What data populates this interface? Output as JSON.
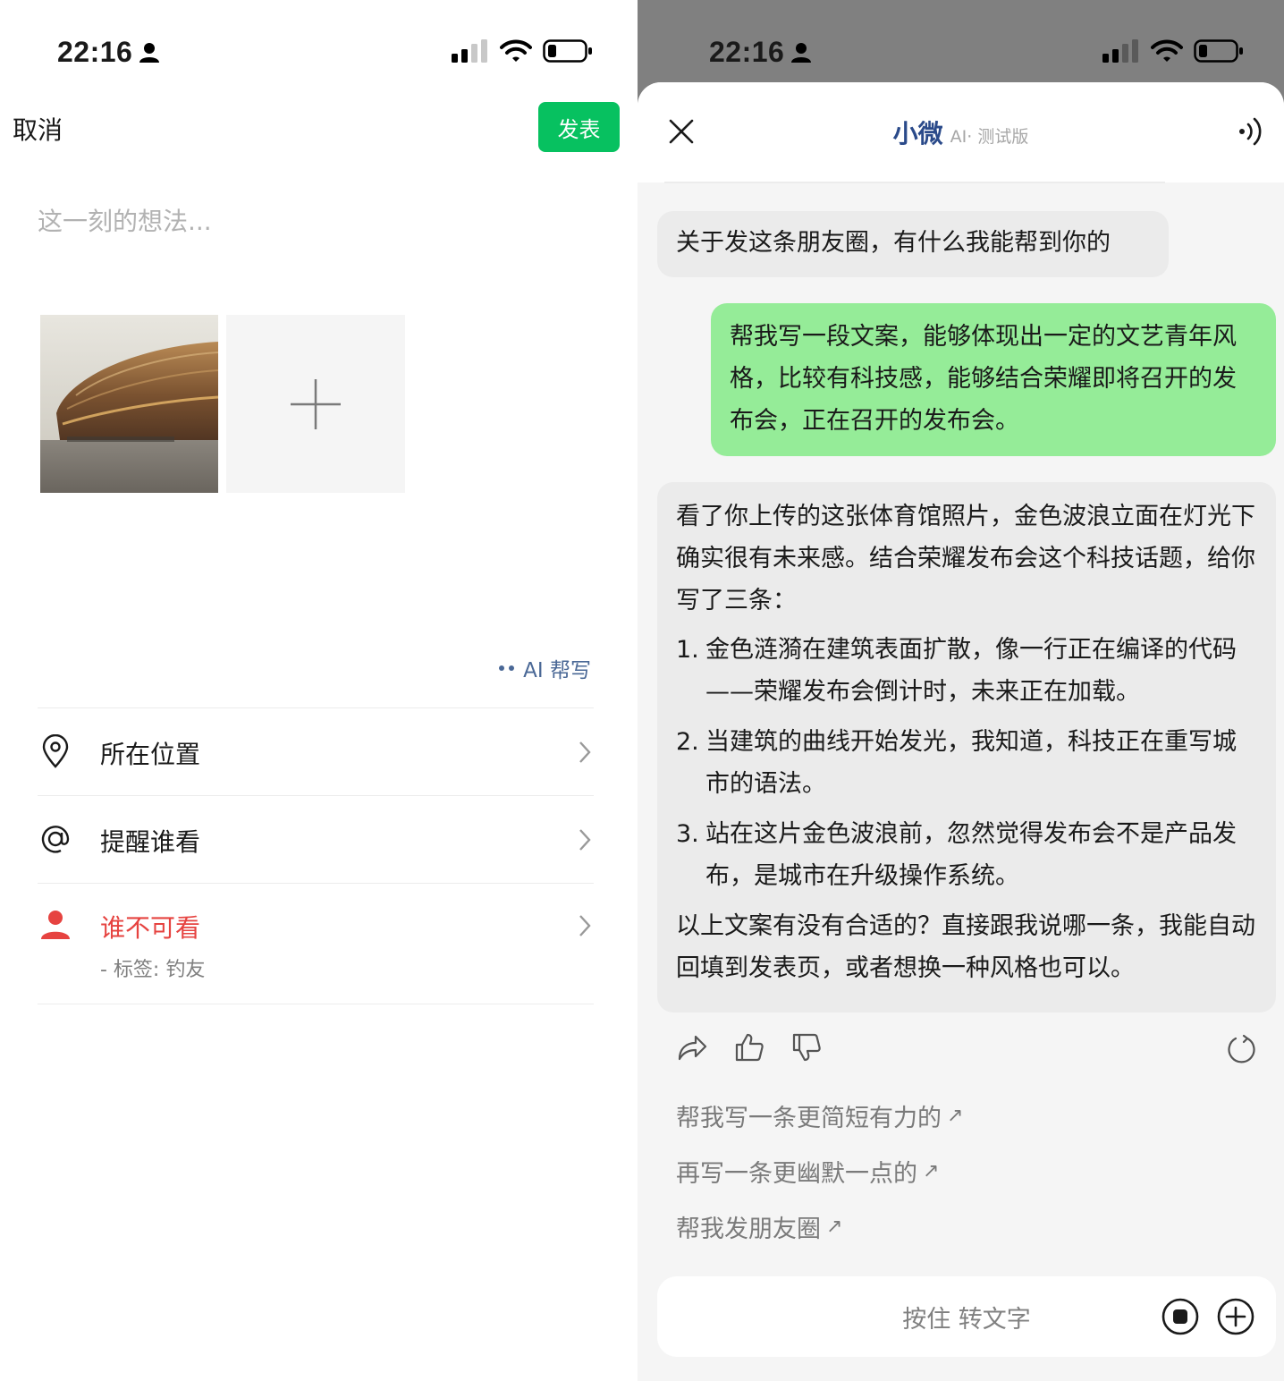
{
  "left": {
    "status": {
      "time": "22:16"
    },
    "cancel_label": "取消",
    "publish_label": "发表",
    "thought_placeholder": "这一刻的想法...",
    "ai_write_label": "AI 帮写",
    "options": [
      {
        "label": "所在位置",
        "icon": "location-pin-icon"
      },
      {
        "label": "提醒谁看",
        "icon": "at-icon"
      },
      {
        "label": "谁不可看",
        "sub": "- 标签: 钓友",
        "icon": "person-icon"
      }
    ],
    "colors": {
      "accent": "#07c160",
      "warning": "#e64340",
      "link": "#4a6896"
    }
  },
  "right": {
    "status": {
      "time": "22:16"
    },
    "title": "小微",
    "subtitle": "AI· 测试版",
    "messages": {
      "greeting": "关于发这条朋友圈，有什么我能帮到你的",
      "user": "帮我写一段文案，能够体现出一定的文艺青年风格，比较有科技感，能够结合荣耀即将召开的发布会，正在召开的发布会。",
      "reply_intro": "看了你上传的这张体育馆照片，金色波浪立面在灯光下确实很有未来感。结合荣耀发布会这个科技话题，给你写了三条：",
      "reply_items": [
        {
          "num": "1.",
          "text": "金色涟漪在建筑表面扩散，像一行正在编译的代码——荣耀发布会倒计时，未来正在加载。"
        },
        {
          "num": "2.",
          "text": "当建筑的曲线开始发光，我知道，科技正在重写城市的语法。"
        },
        {
          "num": "3.",
          "text": "站在这片金色波浪前，忽然觉得发布会不是产品发布，是城市在升级操作系统。"
        }
      ],
      "reply_outro": "以上文案有没有合适的？直接跟我说哪一条，我能自动回填到发表页，或者想换一种风格也可以。"
    },
    "suggestions": [
      {
        "label": "帮我写一条更简短有力的",
        "arrow": "↗"
      },
      {
        "label": "再写一条更幽默一点的",
        "arrow": "↗"
      },
      {
        "label": "帮我发朋友圈",
        "arrow": "↗"
      }
    ],
    "input_label": "按住 转文字",
    "colors": {
      "user_bubble": "#95ec98",
      "ai_bubble": "#ebebeb",
      "title": "#2a4a8a"
    }
  }
}
